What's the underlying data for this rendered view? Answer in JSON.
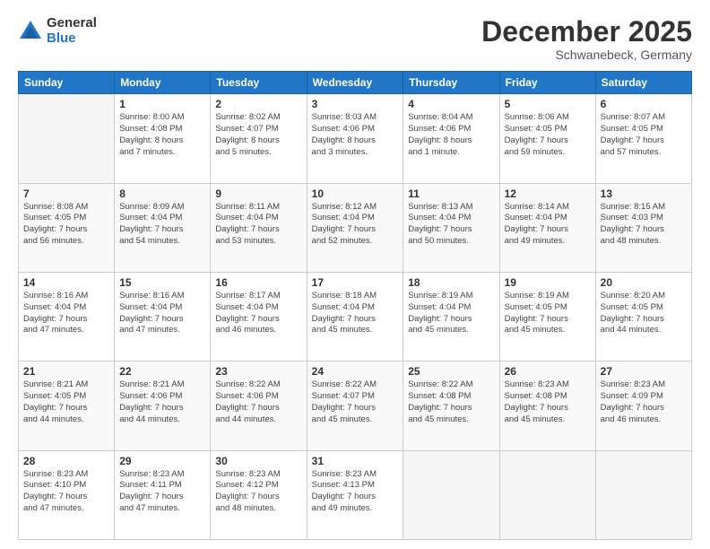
{
  "header": {
    "logo_general": "General",
    "logo_blue": "Blue",
    "month_title": "December 2025",
    "subtitle": "Schwanebeck, Germany"
  },
  "days_of_week": [
    "Sunday",
    "Monday",
    "Tuesday",
    "Wednesday",
    "Thursday",
    "Friday",
    "Saturday"
  ],
  "weeks": [
    [
      {
        "day": "",
        "info": ""
      },
      {
        "day": "1",
        "info": "Sunrise: 8:00 AM\nSunset: 4:08 PM\nDaylight: 8 hours\nand 7 minutes."
      },
      {
        "day": "2",
        "info": "Sunrise: 8:02 AM\nSunset: 4:07 PM\nDaylight: 8 hours\nand 5 minutes."
      },
      {
        "day": "3",
        "info": "Sunrise: 8:03 AM\nSunset: 4:06 PM\nDaylight: 8 hours\nand 3 minutes."
      },
      {
        "day": "4",
        "info": "Sunrise: 8:04 AM\nSunset: 4:06 PM\nDaylight: 8 hours\nand 1 minute."
      },
      {
        "day": "5",
        "info": "Sunrise: 8:06 AM\nSunset: 4:05 PM\nDaylight: 7 hours\nand 59 minutes."
      },
      {
        "day": "6",
        "info": "Sunrise: 8:07 AM\nSunset: 4:05 PM\nDaylight: 7 hours\nand 57 minutes."
      }
    ],
    [
      {
        "day": "7",
        "info": "Sunrise: 8:08 AM\nSunset: 4:05 PM\nDaylight: 7 hours\nand 56 minutes."
      },
      {
        "day": "8",
        "info": "Sunrise: 8:09 AM\nSunset: 4:04 PM\nDaylight: 7 hours\nand 54 minutes."
      },
      {
        "day": "9",
        "info": "Sunrise: 8:11 AM\nSunset: 4:04 PM\nDaylight: 7 hours\nand 53 minutes."
      },
      {
        "day": "10",
        "info": "Sunrise: 8:12 AM\nSunset: 4:04 PM\nDaylight: 7 hours\nand 52 minutes."
      },
      {
        "day": "11",
        "info": "Sunrise: 8:13 AM\nSunset: 4:04 PM\nDaylight: 7 hours\nand 50 minutes."
      },
      {
        "day": "12",
        "info": "Sunrise: 8:14 AM\nSunset: 4:04 PM\nDaylight: 7 hours\nand 49 minutes."
      },
      {
        "day": "13",
        "info": "Sunrise: 8:15 AM\nSunset: 4:03 PM\nDaylight: 7 hours\nand 48 minutes."
      }
    ],
    [
      {
        "day": "14",
        "info": "Sunrise: 8:16 AM\nSunset: 4:04 PM\nDaylight: 7 hours\nand 47 minutes."
      },
      {
        "day": "15",
        "info": "Sunrise: 8:16 AM\nSunset: 4:04 PM\nDaylight: 7 hours\nand 47 minutes."
      },
      {
        "day": "16",
        "info": "Sunrise: 8:17 AM\nSunset: 4:04 PM\nDaylight: 7 hours\nand 46 minutes."
      },
      {
        "day": "17",
        "info": "Sunrise: 8:18 AM\nSunset: 4:04 PM\nDaylight: 7 hours\nand 45 minutes."
      },
      {
        "day": "18",
        "info": "Sunrise: 8:19 AM\nSunset: 4:04 PM\nDaylight: 7 hours\nand 45 minutes."
      },
      {
        "day": "19",
        "info": "Sunrise: 8:19 AM\nSunset: 4:05 PM\nDaylight: 7 hours\nand 45 minutes."
      },
      {
        "day": "20",
        "info": "Sunrise: 8:20 AM\nSunset: 4:05 PM\nDaylight: 7 hours\nand 44 minutes."
      }
    ],
    [
      {
        "day": "21",
        "info": "Sunrise: 8:21 AM\nSunset: 4:05 PM\nDaylight: 7 hours\nand 44 minutes."
      },
      {
        "day": "22",
        "info": "Sunrise: 8:21 AM\nSunset: 4:06 PM\nDaylight: 7 hours\nand 44 minutes."
      },
      {
        "day": "23",
        "info": "Sunrise: 8:22 AM\nSunset: 4:06 PM\nDaylight: 7 hours\nand 44 minutes."
      },
      {
        "day": "24",
        "info": "Sunrise: 8:22 AM\nSunset: 4:07 PM\nDaylight: 7 hours\nand 45 minutes."
      },
      {
        "day": "25",
        "info": "Sunrise: 8:22 AM\nSunset: 4:08 PM\nDaylight: 7 hours\nand 45 minutes."
      },
      {
        "day": "26",
        "info": "Sunrise: 8:23 AM\nSunset: 4:08 PM\nDaylight: 7 hours\nand 45 minutes."
      },
      {
        "day": "27",
        "info": "Sunrise: 8:23 AM\nSunset: 4:09 PM\nDaylight: 7 hours\nand 46 minutes."
      }
    ],
    [
      {
        "day": "28",
        "info": "Sunrise: 8:23 AM\nSunset: 4:10 PM\nDaylight: 7 hours\nand 47 minutes."
      },
      {
        "day": "29",
        "info": "Sunrise: 8:23 AM\nSunset: 4:11 PM\nDaylight: 7 hours\nand 47 minutes."
      },
      {
        "day": "30",
        "info": "Sunrise: 8:23 AM\nSunset: 4:12 PM\nDaylight: 7 hours\nand 48 minutes."
      },
      {
        "day": "31",
        "info": "Sunrise: 8:23 AM\nSunset: 4:13 PM\nDaylight: 7 hours\nand 49 minutes."
      },
      {
        "day": "",
        "info": ""
      },
      {
        "day": "",
        "info": ""
      },
      {
        "day": "",
        "info": ""
      }
    ]
  ]
}
